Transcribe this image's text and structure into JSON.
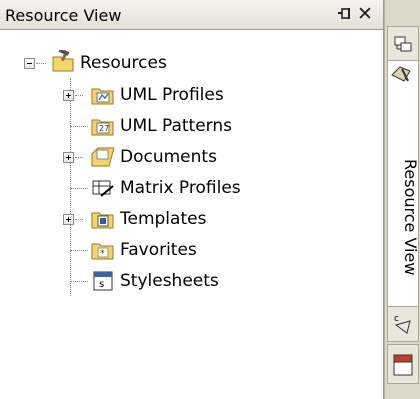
{
  "panel": {
    "title": "Resource View",
    "pin_icon": "pin-icon",
    "close_icon": "close-icon",
    "close_glyph": "✕"
  },
  "tree": {
    "root": {
      "label": "Resources",
      "expanded": true,
      "icon": "resources-toolbox-icon"
    },
    "children": [
      {
        "label": "UML Profiles",
        "expandable": true,
        "icon": "uml-profiles-folder-icon"
      },
      {
        "label": "UML Patterns",
        "expandable": false,
        "icon": "uml-patterns-folder-icon"
      },
      {
        "label": "Documents",
        "expandable": true,
        "icon": "documents-folder-icon"
      },
      {
        "label": "Matrix Profiles",
        "expandable": false,
        "icon": "matrix-profiles-icon"
      },
      {
        "label": "Templates",
        "expandable": true,
        "icon": "templates-folder-icon"
      },
      {
        "label": "Favorites",
        "expandable": false,
        "icon": "favorites-folder-icon"
      },
      {
        "label": "Stylesheets",
        "expandable": false,
        "icon": "stylesheets-icon"
      }
    ]
  },
  "side_strip": {
    "vertical_tab_label": "Resource View",
    "tabs": [
      "project-browser-tab-icon",
      "resource-view-tab-icon",
      "code-tab-icon",
      "notes-tab-icon"
    ]
  },
  "colors": {
    "title_bar_top": "#f5f4ee",
    "title_bar_bottom": "#e2e1d6",
    "strip_background": "#dcd9c9",
    "folder_yellow": "#f2d56b"
  }
}
